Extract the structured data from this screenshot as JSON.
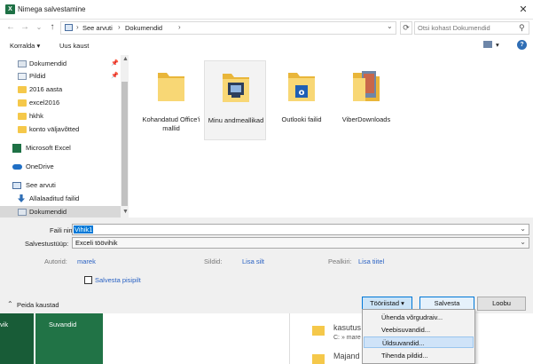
{
  "window": {
    "title": "Nimega salvestamine",
    "close_glyph": "✕"
  },
  "nav": {
    "back": "←",
    "forward": "→",
    "dropdown": "⌄",
    "up": "↑"
  },
  "address": {
    "crumbs": [
      "See arvuti",
      "Dokumendid"
    ],
    "sep": "›",
    "dropdown": "⌄",
    "refresh": "⟳"
  },
  "search": {
    "placeholder": "Otsi kohast Dokumendid",
    "icon": "⚲"
  },
  "toolbar": {
    "organize": "Korralda",
    "organize_arrow": "▾",
    "new_folder": "Uus kaust",
    "view_arrow": "▾",
    "help": "?"
  },
  "sidebar": {
    "items": [
      {
        "label": "Dokumendid",
        "pinned": true
      },
      {
        "label": "Pildid",
        "pinned": true
      },
      {
        "label": "2016 aasta"
      },
      {
        "label": "excel2016"
      },
      {
        "label": "hkhk"
      },
      {
        "label": "konto väljavõtted"
      },
      {
        "label": "Microsoft Excel"
      },
      {
        "label": "OneDrive"
      },
      {
        "label": "See arvuti"
      },
      {
        "label": "Allalaaditud failid"
      },
      {
        "label": "Dokumendid"
      }
    ],
    "pin_glyph": "📌",
    "up_arrow": "▲",
    "down_arrow": "▼"
  },
  "files": [
    {
      "label": "Kohandatud Office'i mallid"
    },
    {
      "label": "Minu andmeallikad"
    },
    {
      "label": "Outlooki failid"
    },
    {
      "label": "ViberDownloads"
    }
  ],
  "save": {
    "filename_label": "Faili nimi:",
    "filename_value": "Vihik1",
    "filetype_label": "Salvestustüüp:",
    "filetype_value": "Exceli töövihik",
    "dropdown_arrow": "⌄"
  },
  "meta": {
    "authors_label": "Autorid:",
    "authors_value": "marek",
    "tags_label": "Sildid:",
    "tags_value": "Lisa silt",
    "title_label": "Pealkiri:",
    "title_value": "Lisa tiitel"
  },
  "thumbnail": {
    "label": "Salvesta pisipilt",
    "checked": false
  },
  "footer": {
    "hide_folders": "Peida kaustad",
    "hide_arrow": "⌃",
    "tools": "Tööriistad",
    "tools_arrow": "▾",
    "save": "Salvesta",
    "cancel": "Loobu"
  },
  "tools_menu": [
    {
      "label": "Ühenda võrgudraiv..."
    },
    {
      "label": "Veebisuvandid..."
    },
    {
      "label": "Üldsuvandid...",
      "highlighted": true
    },
    {
      "label": "Tihenda pildid..."
    }
  ],
  "background": {
    "green_label": "Suvandid",
    "left_fragment": "vik",
    "recent_name": "kasutus",
    "recent_path": "C: » mare",
    "recent_name2": "Majand"
  },
  "colors": {
    "accent": "#0078d7",
    "excel_green": "#217346",
    "folder": "#f5c84a",
    "link": "#2a62c3"
  }
}
